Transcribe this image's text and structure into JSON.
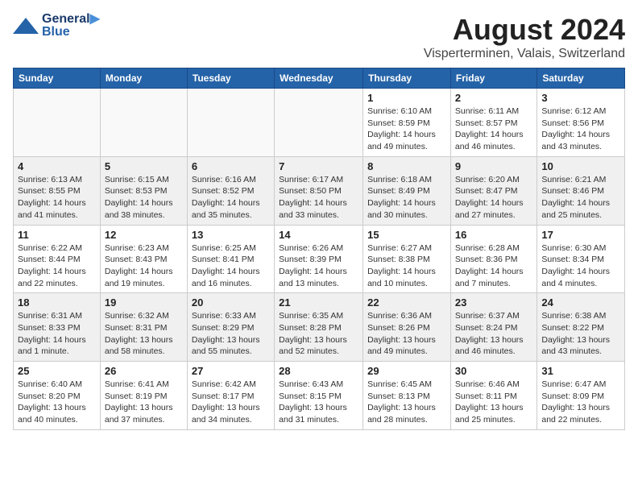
{
  "header": {
    "logo_line1": "General",
    "logo_line2": "Blue",
    "month": "August 2024",
    "location": "Visperterminen, Valais, Switzerland"
  },
  "weekdays": [
    "Sunday",
    "Monday",
    "Tuesday",
    "Wednesday",
    "Thursday",
    "Friday",
    "Saturday"
  ],
  "weeks": [
    [
      {
        "day": "",
        "info": ""
      },
      {
        "day": "",
        "info": ""
      },
      {
        "day": "",
        "info": ""
      },
      {
        "day": "",
        "info": ""
      },
      {
        "day": "1",
        "info": "Sunrise: 6:10 AM\nSunset: 8:59 PM\nDaylight: 14 hours and 49 minutes."
      },
      {
        "day": "2",
        "info": "Sunrise: 6:11 AM\nSunset: 8:57 PM\nDaylight: 14 hours and 46 minutes."
      },
      {
        "day": "3",
        "info": "Sunrise: 6:12 AM\nSunset: 8:56 PM\nDaylight: 14 hours and 43 minutes."
      }
    ],
    [
      {
        "day": "4",
        "info": "Sunrise: 6:13 AM\nSunset: 8:55 PM\nDaylight: 14 hours and 41 minutes."
      },
      {
        "day": "5",
        "info": "Sunrise: 6:15 AM\nSunset: 8:53 PM\nDaylight: 14 hours and 38 minutes."
      },
      {
        "day": "6",
        "info": "Sunrise: 6:16 AM\nSunset: 8:52 PM\nDaylight: 14 hours and 35 minutes."
      },
      {
        "day": "7",
        "info": "Sunrise: 6:17 AM\nSunset: 8:50 PM\nDaylight: 14 hours and 33 minutes."
      },
      {
        "day": "8",
        "info": "Sunrise: 6:18 AM\nSunset: 8:49 PM\nDaylight: 14 hours and 30 minutes."
      },
      {
        "day": "9",
        "info": "Sunrise: 6:20 AM\nSunset: 8:47 PM\nDaylight: 14 hours and 27 minutes."
      },
      {
        "day": "10",
        "info": "Sunrise: 6:21 AM\nSunset: 8:46 PM\nDaylight: 14 hours and 25 minutes."
      }
    ],
    [
      {
        "day": "11",
        "info": "Sunrise: 6:22 AM\nSunset: 8:44 PM\nDaylight: 14 hours and 22 minutes."
      },
      {
        "day": "12",
        "info": "Sunrise: 6:23 AM\nSunset: 8:43 PM\nDaylight: 14 hours and 19 minutes."
      },
      {
        "day": "13",
        "info": "Sunrise: 6:25 AM\nSunset: 8:41 PM\nDaylight: 14 hours and 16 minutes."
      },
      {
        "day": "14",
        "info": "Sunrise: 6:26 AM\nSunset: 8:39 PM\nDaylight: 14 hours and 13 minutes."
      },
      {
        "day": "15",
        "info": "Sunrise: 6:27 AM\nSunset: 8:38 PM\nDaylight: 14 hours and 10 minutes."
      },
      {
        "day": "16",
        "info": "Sunrise: 6:28 AM\nSunset: 8:36 PM\nDaylight: 14 hours and 7 minutes."
      },
      {
        "day": "17",
        "info": "Sunrise: 6:30 AM\nSunset: 8:34 PM\nDaylight: 14 hours and 4 minutes."
      }
    ],
    [
      {
        "day": "18",
        "info": "Sunrise: 6:31 AM\nSunset: 8:33 PM\nDaylight: 14 hours and 1 minute."
      },
      {
        "day": "19",
        "info": "Sunrise: 6:32 AM\nSunset: 8:31 PM\nDaylight: 13 hours and 58 minutes."
      },
      {
        "day": "20",
        "info": "Sunrise: 6:33 AM\nSunset: 8:29 PM\nDaylight: 13 hours and 55 minutes."
      },
      {
        "day": "21",
        "info": "Sunrise: 6:35 AM\nSunset: 8:28 PM\nDaylight: 13 hours and 52 minutes."
      },
      {
        "day": "22",
        "info": "Sunrise: 6:36 AM\nSunset: 8:26 PM\nDaylight: 13 hours and 49 minutes."
      },
      {
        "day": "23",
        "info": "Sunrise: 6:37 AM\nSunset: 8:24 PM\nDaylight: 13 hours and 46 minutes."
      },
      {
        "day": "24",
        "info": "Sunrise: 6:38 AM\nSunset: 8:22 PM\nDaylight: 13 hours and 43 minutes."
      }
    ],
    [
      {
        "day": "25",
        "info": "Sunrise: 6:40 AM\nSunset: 8:20 PM\nDaylight: 13 hours and 40 minutes."
      },
      {
        "day": "26",
        "info": "Sunrise: 6:41 AM\nSunset: 8:19 PM\nDaylight: 13 hours and 37 minutes."
      },
      {
        "day": "27",
        "info": "Sunrise: 6:42 AM\nSunset: 8:17 PM\nDaylight: 13 hours and 34 minutes."
      },
      {
        "day": "28",
        "info": "Sunrise: 6:43 AM\nSunset: 8:15 PM\nDaylight: 13 hours and 31 minutes."
      },
      {
        "day": "29",
        "info": "Sunrise: 6:45 AM\nSunset: 8:13 PM\nDaylight: 13 hours and 28 minutes."
      },
      {
        "day": "30",
        "info": "Sunrise: 6:46 AM\nSunset: 8:11 PM\nDaylight: 13 hours and 25 minutes."
      },
      {
        "day": "31",
        "info": "Sunrise: 6:47 AM\nSunset: 8:09 PM\nDaylight: 13 hours and 22 minutes."
      }
    ]
  ]
}
